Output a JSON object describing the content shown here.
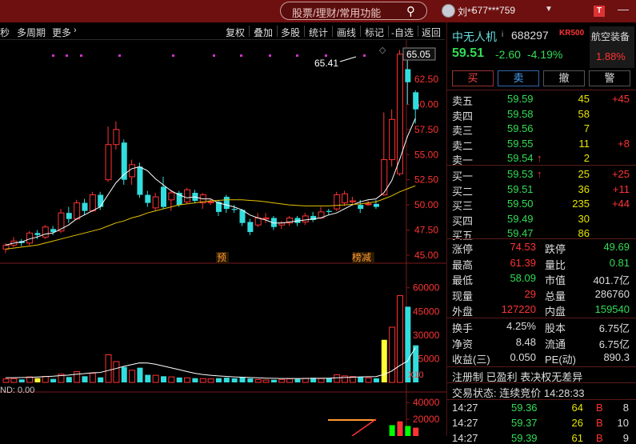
{
  "topbar": {
    "search_placeholder": "股票/理财/常用功能",
    "user": "刘**",
    "account": "577***759",
    "t_badge": "T"
  },
  "toolbar": {
    "left": [
      "秒",
      "多周期",
      "更多"
    ],
    "more_arrow": "›",
    "right": [
      "复权",
      "叠加",
      "多股",
      "统计",
      "画线",
      "标记",
      "-自选",
      "返回"
    ]
  },
  "stock": {
    "name": "中无人机",
    "name_suffix": "i",
    "code": "688297",
    "kr_badge": "KR500",
    "sector": "航空装备",
    "sector_change": "1.88%",
    "price": "59.51",
    "change": "-2.60",
    "change_pct": "-4.19%"
  },
  "trade_buttons": [
    "买",
    "卖",
    "撤",
    "警"
  ],
  "order_book": {
    "asks": [
      {
        "label": "卖五",
        "price": "59.59",
        "vol": "45",
        "chg": "+45"
      },
      {
        "label": "卖四",
        "price": "59.58",
        "vol": "58",
        "chg": ""
      },
      {
        "label": "卖三",
        "price": "59.56",
        "vol": "7",
        "chg": ""
      },
      {
        "label": "卖二",
        "price": "59.55",
        "vol": "11",
        "chg": "+8"
      },
      {
        "label": "卖一",
        "price": "59.54",
        "vol": "2",
        "chg": "",
        "arrow": "↑"
      }
    ],
    "bids": [
      {
        "label": "买一",
        "price": "59.53",
        "vol": "25",
        "chg": "+25",
        "arrow": "↑"
      },
      {
        "label": "买二",
        "price": "59.51",
        "vol": "36",
        "chg": "+11"
      },
      {
        "label": "买三",
        "price": "59.50",
        "vol": "235",
        "chg": "+44"
      },
      {
        "label": "买四",
        "price": "59.49",
        "vol": "30",
        "chg": ""
      },
      {
        "label": "买五",
        "price": "59.47",
        "vol": "86",
        "chg": ""
      }
    ]
  },
  "quote": [
    {
      "l1": "涨停",
      "v1": "74.53",
      "c1": "red",
      "l2": "跌停",
      "v2": "49.69",
      "c2": "green"
    },
    {
      "l1": "最高",
      "v1": "61.39",
      "c1": "red",
      "l2": "量比",
      "v2": "0.81",
      "c2": "green"
    },
    {
      "l1": "最低",
      "v1": "58.09",
      "c1": "green",
      "l2": "市值",
      "v2": "401.7亿",
      "c2": "wht"
    },
    {
      "l1": "现量",
      "v1": "29",
      "c1": "red",
      "l2": "总量",
      "v2": "286760",
      "c2": "wht"
    },
    {
      "l1": "外盘",
      "v1": "127220",
      "c1": "red",
      "l2": "内盘",
      "v2": "159540",
      "c2": "green"
    }
  ],
  "stats": [
    {
      "l1": "换手",
      "v1": "4.25%",
      "l2": "股本",
      "v2": "6.75亿"
    },
    {
      "l1": "净资",
      "v1": "8.48",
      "l2": "流通",
      "v2": "6.75亿"
    },
    {
      "l1": "收益(三)",
      "v1": "0.050",
      "l2": "PE(动)",
      "v2": "890.3"
    }
  ],
  "tags": "注册制 已盈利 表决权无差异",
  "trade_status": "交易状态: 连续竞价 14:28:33",
  "ticks": [
    {
      "time": "14:27",
      "price": "59.36",
      "vol": "64",
      "side": "B",
      "n": "8"
    },
    {
      "time": "14:27",
      "price": "59.37",
      "vol": "26",
      "side": "B",
      "n": "10"
    },
    {
      "time": "14:27",
      "price": "59.39",
      "vol": "61",
      "side": "B",
      "n": "9"
    }
  ],
  "chart_data": {
    "type": "candlestick",
    "price_axis": {
      "ticks": [
        "62.50",
        "60.00",
        "57.50",
        "55.00",
        "52.50",
        "50.00",
        "47.50",
        "45.00"
      ],
      "current": "65.05",
      "range": [
        44.2,
        66.4
      ]
    },
    "max_label": "65.41",
    "markers": [
      "预",
      "榜减"
    ],
    "candles": [
      {
        "o": 45.6,
        "c": 46.0,
        "h": 46.2,
        "l": 45.2
      },
      {
        "o": 46.0,
        "c": 46.4,
        "h": 46.8,
        "l": 45.8
      },
      {
        "o": 46.4,
        "c": 46.2,
        "h": 46.6,
        "l": 45.9
      },
      {
        "o": 46.2,
        "c": 47.2,
        "h": 47.4,
        "l": 46.0
      },
      {
        "o": 47.2,
        "c": 47.0,
        "h": 47.5,
        "l": 46.6
      },
      {
        "o": 46.8,
        "c": 47.8,
        "h": 48.0,
        "l": 46.6
      },
      {
        "o": 47.6,
        "c": 47.3,
        "h": 47.9,
        "l": 47.0
      },
      {
        "o": 47.4,
        "c": 49.2,
        "h": 49.6,
        "l": 47.2
      },
      {
        "o": 49.2,
        "c": 48.6,
        "h": 49.8,
        "l": 48.2
      },
      {
        "o": 48.6,
        "c": 50.2,
        "h": 50.5,
        "l": 48.5
      },
      {
        "o": 50.2,
        "c": 49.4,
        "h": 50.6,
        "l": 49.0
      },
      {
        "o": 49.4,
        "c": 51.0,
        "h": 51.3,
        "l": 49.3
      },
      {
        "o": 51.0,
        "c": 49.8,
        "h": 51.3,
        "l": 49.5
      },
      {
        "o": 52.5,
        "c": 56.0,
        "h": 57.8,
        "l": 52.3
      },
      {
        "o": 56.0,
        "c": 57.5,
        "h": 58.3,
        "l": 55.5
      },
      {
        "o": 56.2,
        "c": 52.5,
        "h": 56.5,
        "l": 52.0
      },
      {
        "o": 52.8,
        "c": 54.0,
        "h": 54.5,
        "l": 52.0
      },
      {
        "o": 53.8,
        "c": 51.0,
        "h": 54.2,
        "l": 50.7
      },
      {
        "o": 51.0,
        "c": 50.2,
        "h": 51.4,
        "l": 49.8
      },
      {
        "o": 49.7,
        "c": 50.8,
        "h": 51.2,
        "l": 49.4
      },
      {
        "o": 51.8,
        "c": 49.8,
        "h": 52.8,
        "l": 49.6
      },
      {
        "o": 50.5,
        "c": 51.2,
        "h": 51.5,
        "l": 49.4
      },
      {
        "o": 51.2,
        "c": 50.0,
        "h": 51.4,
        "l": 49.8
      },
      {
        "o": 50.3,
        "c": 51.5,
        "h": 51.7,
        "l": 50.1
      },
      {
        "o": 51.2,
        "c": 50.4,
        "h": 51.5,
        "l": 50.2
      },
      {
        "o": 50.2,
        "c": 51.0,
        "h": 51.2,
        "l": 49.6
      },
      {
        "o": 50.3,
        "c": 50.3,
        "h": 50.6,
        "l": 50.0
      },
      {
        "o": 50.3,
        "c": 49.3,
        "h": 50.5,
        "l": 48.9
      },
      {
        "o": 50.8,
        "c": 49.6,
        "h": 51.0,
        "l": 49.2
      },
      {
        "o": 49.6,
        "c": 49.5,
        "h": 50.0,
        "l": 49.2
      },
      {
        "o": 49.5,
        "c": 48.2,
        "h": 49.6,
        "l": 47.9
      },
      {
        "o": 48.3,
        "c": 47.3,
        "h": 48.6,
        "l": 47.0
      },
      {
        "o": 48.0,
        "c": 48.7,
        "h": 49.2,
        "l": 47.8
      },
      {
        "o": 48.6,
        "c": 48.7,
        "h": 49.2,
        "l": 48.2
      },
      {
        "o": 48.7,
        "c": 47.8,
        "h": 48.9,
        "l": 47.5
      },
      {
        "o": 48.0,
        "c": 48.2,
        "h": 48.4,
        "l": 47.6
      },
      {
        "o": 48.2,
        "c": 48.7,
        "h": 48.9,
        "l": 47.9
      },
      {
        "o": 48.7,
        "c": 48.2,
        "h": 48.9,
        "l": 47.9
      },
      {
        "o": 48.3,
        "c": 48.9,
        "h": 49.2,
        "l": 48.0
      },
      {
        "o": 48.9,
        "c": 48.5,
        "h": 49.3,
        "l": 48.3
      },
      {
        "o": 48.7,
        "c": 49.3,
        "h": 49.8,
        "l": 48.6
      },
      {
        "o": 49.4,
        "c": 49.3,
        "h": 49.6,
        "l": 49.0
      },
      {
        "o": 49.6,
        "c": 51.0,
        "h": 51.3,
        "l": 49.4
      },
      {
        "o": 50.2,
        "c": 51.1,
        "h": 51.4,
        "l": 49.9
      },
      {
        "o": 50.3,
        "c": 50.4,
        "h": 50.8,
        "l": 50.1
      },
      {
        "o": 50.0,
        "c": 49.6,
        "h": 50.5,
        "l": 49.2
      },
      {
        "o": 50.1,
        "c": 50.1,
        "h": 50.4,
        "l": 49.9
      },
      {
        "o": 50.1,
        "c": 49.8,
        "h": 50.5,
        "l": 49.6
      },
      {
        "o": 51.0,
        "c": 54.5,
        "h": 59.2,
        "l": 50.9
      },
      {
        "o": 54.5,
        "c": 58.5,
        "h": 59.5,
        "l": 53.8
      },
      {
        "o": 53.1,
        "c": 65.0,
        "h": 65.41,
        "l": 52.9
      },
      {
        "o": 63.5,
        "c": 62.2,
        "h": 64.5,
        "l": 60.0
      },
      {
        "o": 61.2,
        "c": 59.5,
        "h": 61.4,
        "l": 58.1
      }
    ],
    "ma5": [
      46,
      46.2,
      46.3,
      46.6,
      46.8,
      47.1,
      47.2,
      47.6,
      48.0,
      48.6,
      49.0,
      49.4,
      49.8,
      51.0,
      52.2,
      53.0,
      53.6,
      53.8,
      53.4,
      52.6,
      52.0,
      51.4,
      51.0,
      50.7,
      50.8,
      50.6,
      50.6,
      50.2,
      50.0,
      49.8,
      49.5,
      49.0,
      48.7,
      48.5,
      48.2,
      48.2,
      48.3,
      48.4,
      48.5,
      48.6,
      48.7,
      49.0,
      49.2,
      49.6,
      50.0,
      50.3,
      50.5,
      50.6,
      51.2,
      52.4,
      54.5,
      56.8,
      58.6
    ],
    "ma20": [
      45.6,
      45.7,
      45.8,
      45.9,
      46.0,
      46.2,
      46.4,
      46.6,
      46.8,
      47.0,
      47.2,
      47.4,
      47.6,
      47.9,
      48.2,
      48.4,
      48.7,
      48.9,
      49.2,
      49.4,
      49.6,
      49.8,
      50.0,
      50.1,
      50.2,
      50.3,
      50.4,
      50.45,
      50.5,
      50.5,
      50.5,
      50.45,
      50.4,
      50.3,
      50.2,
      50.1,
      50.0,
      49.95,
      49.9,
      49.9,
      49.9,
      49.9,
      49.95,
      50.0,
      50.05,
      50.1,
      50.2,
      50.3,
      50.6,
      50.9,
      51.3,
      51.6,
      51.9
    ],
    "volume_axis": {
      "ticks": [
        "60000",
        "45000",
        "30000",
        "15000"
      ],
      "unit": "X10"
    },
    "volume": [
      2200,
      2400,
      1900,
      3500,
      2700,
      3800,
      2200,
      5200,
      3400,
      6800,
      3900,
      5800,
      3200,
      17500,
      13200,
      9800,
      7700,
      9300,
      4800,
      4500,
      3900,
      3500,
      3100,
      2900,
      2700,
      2400,
      2200,
      2700,
      3000,
      2600,
      3300,
      2500,
      1800,
      1500,
      1700,
      1900,
      2300,
      2200,
      2600,
      2900,
      2400,
      2800,
      4800,
      4100,
      3700,
      3300,
      2900,
      2600,
      27000,
      35000,
      55000,
      48000,
      23500
    ],
    "volume_ma": [
      3000,
      3000,
      3100,
      3200,
      3400,
      3700,
      3900,
      4300,
      4600,
      5200,
      5600,
      6100,
      6300,
      7500,
      8800,
      10200,
      11300,
      12400,
      12300,
      11500,
      10400,
      9300,
      8100,
      6900,
      5800,
      5000,
      4500,
      4100,
      3800,
      3500,
      3300,
      3100,
      2900,
      2700,
      2600,
      2500,
      2500,
      2500,
      2500,
      2600,
      2600,
      2700,
      2900,
      3100,
      3300,
      3500,
      3600,
      3700,
      5000,
      7200,
      10600,
      13500,
      22000
    ],
    "bottom_panel": {
      "label": "ND: 0.00",
      "ticks": [
        "40000",
        "20000"
      ],
      "bars": [
        {
          "v": 13000,
          "c": "#00ff00"
        },
        {
          "v": 17500,
          "c": "#ff3333"
        },
        {
          "v": 12000,
          "c": "#00ff00"
        },
        {
          "v": 10000,
          "c": "#ff3333"
        }
      ]
    }
  }
}
